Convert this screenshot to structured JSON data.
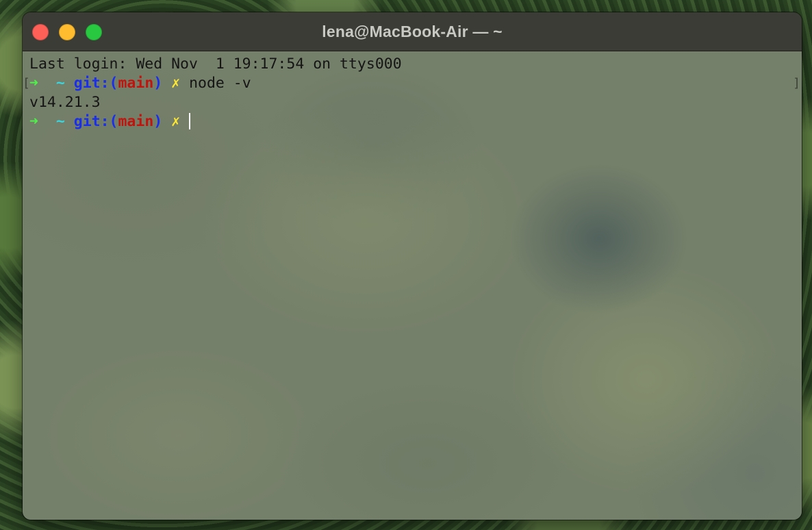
{
  "window": {
    "title": "lena@MacBook-Air — ~",
    "traffic_lights": {
      "close_color": "#fe5f57",
      "minimize_color": "#febc2e",
      "zoom_color": "#28c840"
    }
  },
  "terminal": {
    "login_line": "Last login: Wed Nov  1 19:17:54 on ttys000",
    "prompt": {
      "arrow": "➜",
      "dir": "~",
      "git_prefix": "git:(",
      "branch": "main",
      "git_suffix": ")",
      "dirty_marker": "✗"
    },
    "command": "node -v",
    "output": "v14.21.3",
    "open_bracket": "[",
    "close_bracket": "]"
  },
  "colors": {
    "arrow": "#4ff04a",
    "dir": "#37d6e0",
    "git": "#1b2ee8",
    "branch": "#c0140f",
    "dirty": "#ffe831"
  }
}
